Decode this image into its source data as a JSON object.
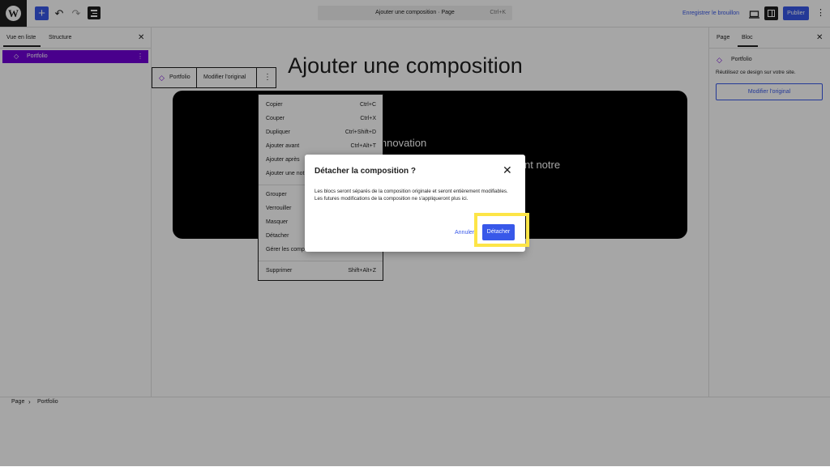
{
  "topbar": {
    "logo_letter": "W",
    "add_label": "+",
    "undo_glyph": "↶",
    "redo_glyph": "↷",
    "command_title": "Ajouter une composition · Page",
    "command_shortcut": "Ctrl+K",
    "save_draft": "Enregistrer le brouillon",
    "publish": "Publier",
    "more_glyph": "⋮"
  },
  "left_panel": {
    "tabs": [
      {
        "label": "Vue en liste"
      },
      {
        "label": "Structure"
      }
    ],
    "close_glyph": "✕",
    "items": [
      {
        "label": "Portfolio",
        "icon": "pattern-icon",
        "glyph": "◇"
      }
    ],
    "item_dots": "⋮"
  },
  "canvas": {
    "page_title": "Ajouter une composition",
    "block_toolbar": {
      "icon_glyph": "◇",
      "portfolio_label": "Portfolio",
      "edit_original": "Modifier l'original",
      "more_glyph": "⋮"
    },
    "hero_fragments": [
      "innovation",
      "nt notre"
    ]
  },
  "context_menu": {
    "groups": [
      [
        {
          "label": "Copier",
          "shortcut": "Ctrl+C"
        },
        {
          "label": "Couper",
          "shortcut": "Ctrl+X"
        },
        {
          "label": "Dupliquer",
          "shortcut": "Ctrl+Shift+D"
        },
        {
          "label": "Ajouter avant",
          "shortcut": "Ctrl+Alt+T"
        },
        {
          "label": "Ajouter après",
          "shortcut": ""
        },
        {
          "label": "Ajouter une not",
          "shortcut": ""
        }
      ],
      [
        {
          "label": "Grouper",
          "shortcut": ""
        },
        {
          "label": "Verrouiller",
          "shortcut": ""
        },
        {
          "label": "Masquer",
          "shortcut": ""
        },
        {
          "label": "Détacher",
          "shortcut": ""
        },
        {
          "label": "Gérer les compo",
          "shortcut": ""
        }
      ],
      [
        {
          "label": "Supprimer",
          "shortcut": "Shift+Alt+Z"
        }
      ]
    ]
  },
  "right_panel": {
    "tabs": [
      {
        "label": "Page"
      },
      {
        "label": "Bloc"
      }
    ],
    "close_glyph": "✕",
    "block_icon_glyph": "◇",
    "block_name": "Portfolio",
    "block_description": "Réutilisez ce design sur votre site.",
    "edit_original": "Modifier l'original"
  },
  "footer": {
    "breadcrumb": [
      {
        "label": "Page"
      },
      {
        "label": "Portfolio"
      }
    ],
    "separator": "›"
  },
  "modal": {
    "title": "Détacher la composition ?",
    "close_glyph": "✕",
    "body": "Les blocs seront séparés de la composition originale et seront entièrement modifiables. Les futures modifications de la composition ne s'appliqueront plus ici.",
    "cancel": "Annuler",
    "confirm": "Détacher"
  },
  "colors": {
    "accent": "#3858e9",
    "selected_block": "#7100d8",
    "highlight": "#fde547",
    "dark": "#1e1e1e"
  }
}
